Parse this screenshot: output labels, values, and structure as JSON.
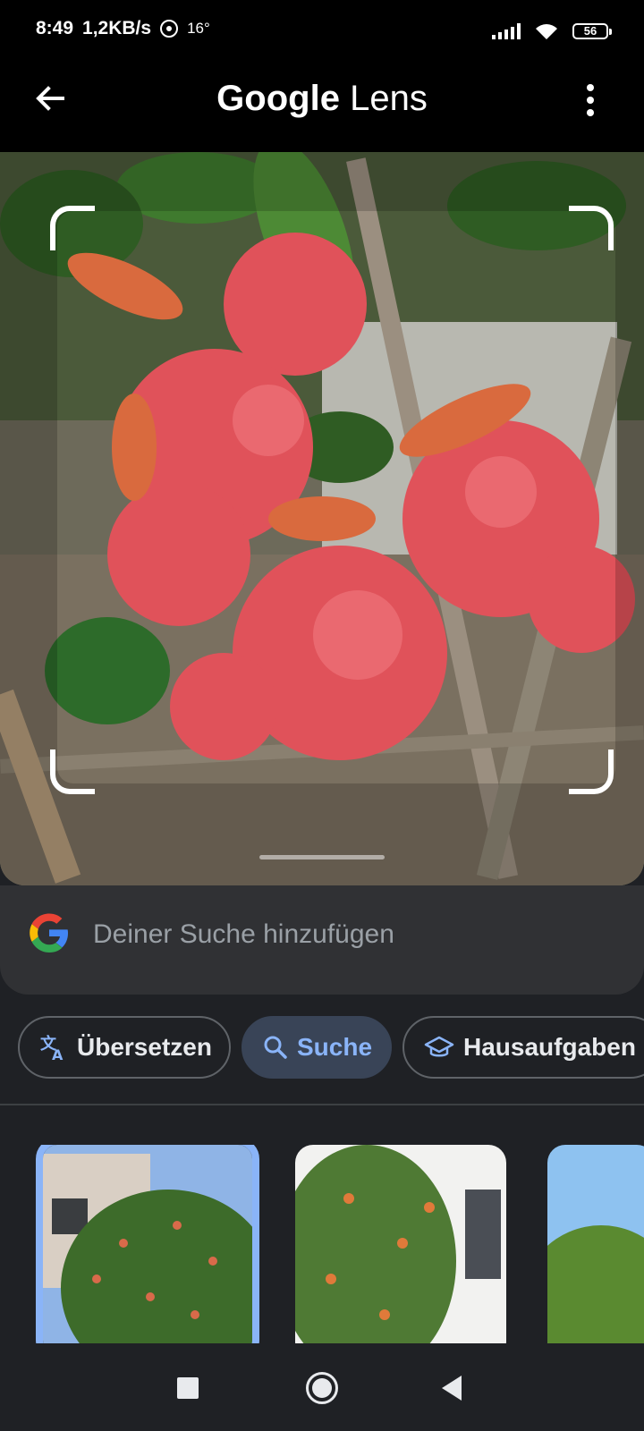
{
  "status_bar": {
    "time": "8:49",
    "network_speed": "1,2KB/s",
    "temperature": "16°",
    "battery": "56",
    "icons": [
      "record-icon",
      "signal-icon",
      "wifi-icon",
      "battery-icon"
    ]
  },
  "header": {
    "title_brand": "Google",
    "title_product": "Lens",
    "back_icon": "arrow-back-icon",
    "menu_icon": "more-vert-icon"
  },
  "search": {
    "placeholder": "Deiner Suche hinzufügen",
    "logo_icon": "google-g-icon"
  },
  "chips": [
    {
      "label": "Übersetzen",
      "icon": "translate-icon",
      "active": false
    },
    {
      "label": "Suche",
      "icon": "search-icon",
      "active": true
    },
    {
      "label": "Hausaufgaben",
      "icon": "school-icon",
      "active": false
    }
  ],
  "colors": {
    "accent": "#8ab4f8",
    "active_chip_bg": "#394457",
    "panel": "#303134",
    "background": "#1f2125"
  },
  "nav": {
    "icons": [
      "recents-square-icon",
      "home-circle-icon",
      "back-triangle-icon"
    ]
  }
}
